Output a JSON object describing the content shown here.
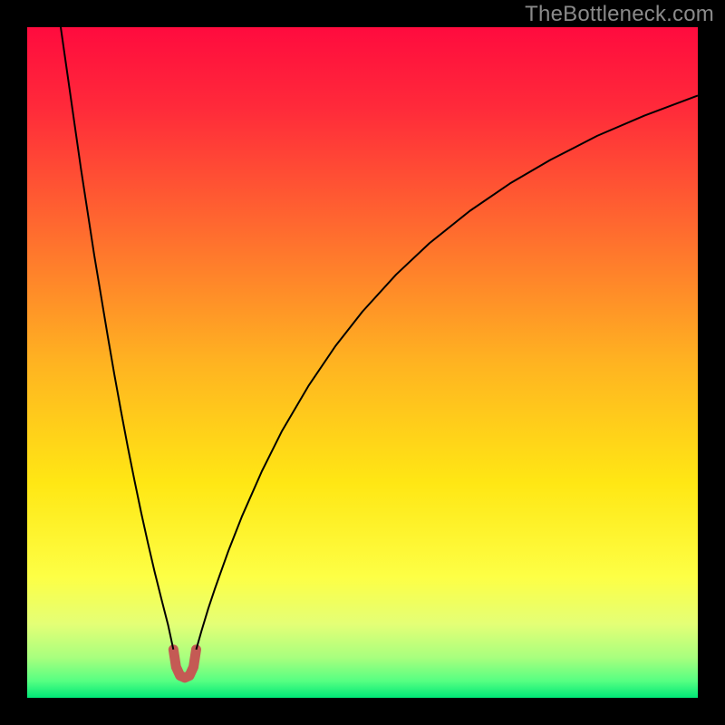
{
  "watermark": "TheBottleneck.com",
  "chart_data": {
    "type": "line",
    "title": "",
    "xlabel": "",
    "ylabel": "",
    "xlim": [
      0,
      100
    ],
    "ylim": [
      0,
      100
    ],
    "grid": false,
    "legend": false,
    "background": {
      "type": "vertical-gradient",
      "stops": [
        {
          "offset": 0.0,
          "color": "#ff0b3e"
        },
        {
          "offset": 0.12,
          "color": "#ff2a3a"
        },
        {
          "offset": 0.3,
          "color": "#ff6a2f"
        },
        {
          "offset": 0.5,
          "color": "#ffb321"
        },
        {
          "offset": 0.68,
          "color": "#ffe714"
        },
        {
          "offset": 0.82,
          "color": "#fdff45"
        },
        {
          "offset": 0.89,
          "color": "#e4ff76"
        },
        {
          "offset": 0.94,
          "color": "#a8ff7e"
        },
        {
          "offset": 0.975,
          "color": "#56ff82"
        },
        {
          "offset": 1.0,
          "color": "#00e877"
        }
      ]
    },
    "series": [
      {
        "name": "left-branch",
        "style": {
          "stroke": "#000000",
          "width": 2
        },
        "x": [
          5,
          6,
          7,
          8,
          9,
          10,
          11,
          12,
          13,
          14,
          15,
          16,
          17,
          18,
          19,
          20,
          21,
          21.8
        ],
        "y": [
          100,
          93,
          86,
          79,
          72.5,
          66,
          60,
          54,
          48.2,
          42.7,
          37.4,
          32.4,
          27.6,
          23.1,
          18.8,
          14.8,
          10.9,
          7.2
        ]
      },
      {
        "name": "right-branch",
        "style": {
          "stroke": "#000000",
          "width": 2
        },
        "x": [
          25.2,
          26,
          27,
          28,
          30,
          32,
          35,
          38,
          42,
          46,
          50,
          55,
          60,
          66,
          72,
          78,
          85,
          92,
          100
        ],
        "y": [
          7.2,
          10.0,
          13.3,
          16.3,
          21.9,
          27.0,
          33.8,
          39.8,
          46.6,
          52.5,
          57.6,
          63.1,
          67.8,
          72.6,
          76.7,
          80.2,
          83.8,
          86.8,
          89.8
        ]
      },
      {
        "name": "trough-band",
        "style": {
          "stroke": "#c45a54",
          "width": 11,
          "linecap": "round"
        },
        "x": [
          21.8,
          22.2,
          22.8,
          23.5,
          24.2,
          24.8,
          25.2
        ],
        "y": [
          7.2,
          4.6,
          3.3,
          3.0,
          3.3,
          4.6,
          7.2
        ]
      }
    ],
    "trough": {
      "x_center": 23.5,
      "y_min": 3.0
    }
  }
}
